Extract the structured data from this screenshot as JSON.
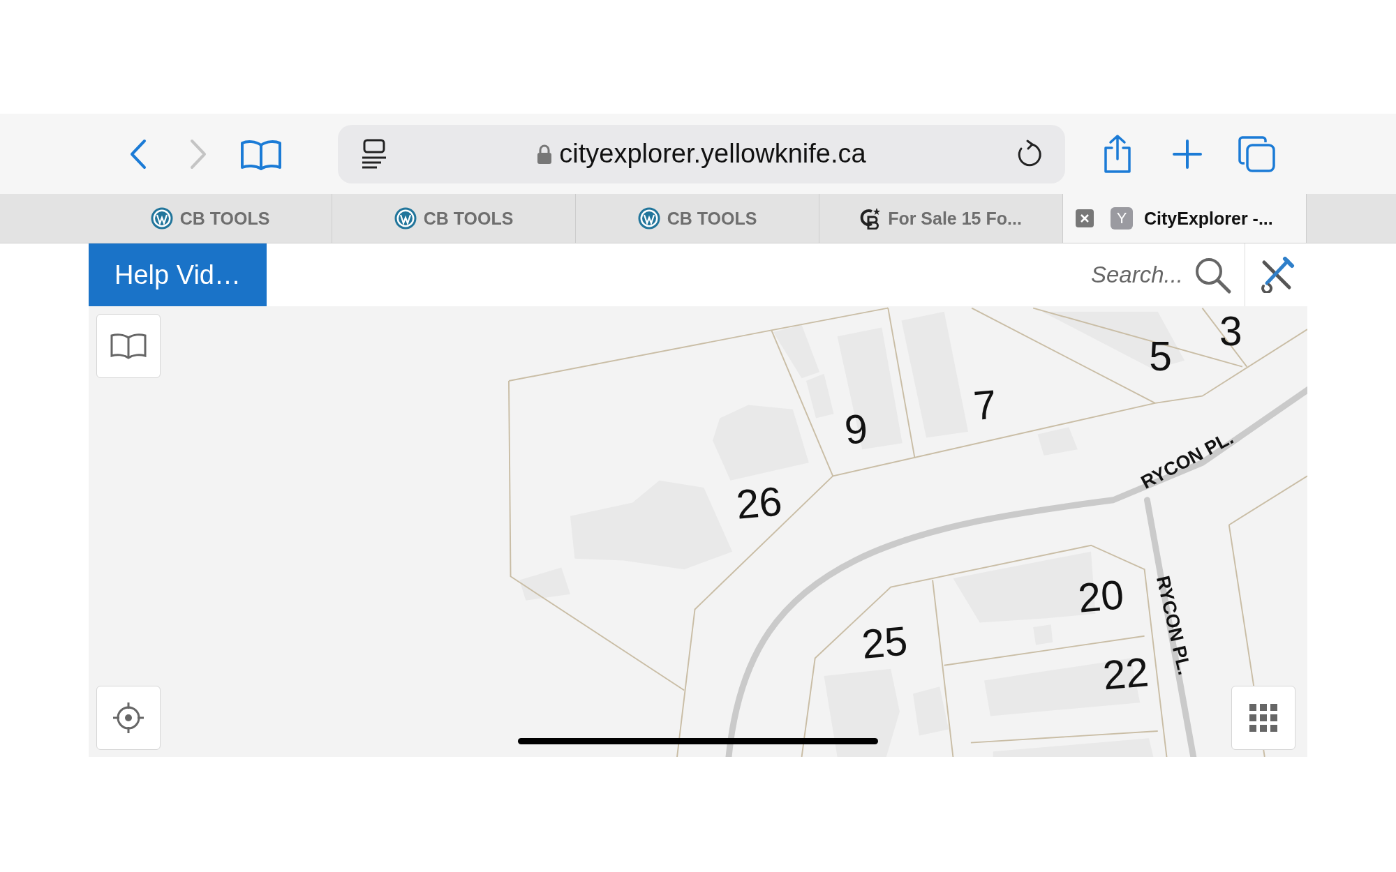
{
  "toolbar": {
    "back_enabled": true,
    "forward_enabled": false,
    "url": "cityexplorer.yellowknife.ca",
    "secure": true
  },
  "tabs": [
    {
      "label": "CB TOOLS",
      "kind": "wordpress",
      "selected": false
    },
    {
      "label": "CB TOOLS",
      "kind": "wordpress",
      "selected": false
    },
    {
      "label": "CB TOOLS",
      "kind": "wordpress",
      "selected": false
    },
    {
      "label": "For Sale 15 Fo...",
      "kind": "cb",
      "selected": false
    },
    {
      "label": "CityExplorer -...",
      "kind": "letter",
      "icon_letter": "Y",
      "selected": true
    }
  ],
  "page": {
    "help_button": "Help Vid…",
    "search": {
      "placeholder": "Search..."
    }
  },
  "map": {
    "labels": [
      {
        "text": "3",
        "kind": "address"
      },
      {
        "text": "5",
        "kind": "address"
      },
      {
        "text": "7",
        "kind": "address"
      },
      {
        "text": "9",
        "kind": "address"
      },
      {
        "text": "26",
        "kind": "address"
      },
      {
        "text": "RYCON PL.",
        "kind": "street"
      },
      {
        "text": "20",
        "kind": "address"
      },
      {
        "text": "25",
        "kind": "address"
      },
      {
        "text": "22",
        "kind": "address"
      },
      {
        "text": "RYCON PL.",
        "kind": "street"
      }
    ]
  }
}
